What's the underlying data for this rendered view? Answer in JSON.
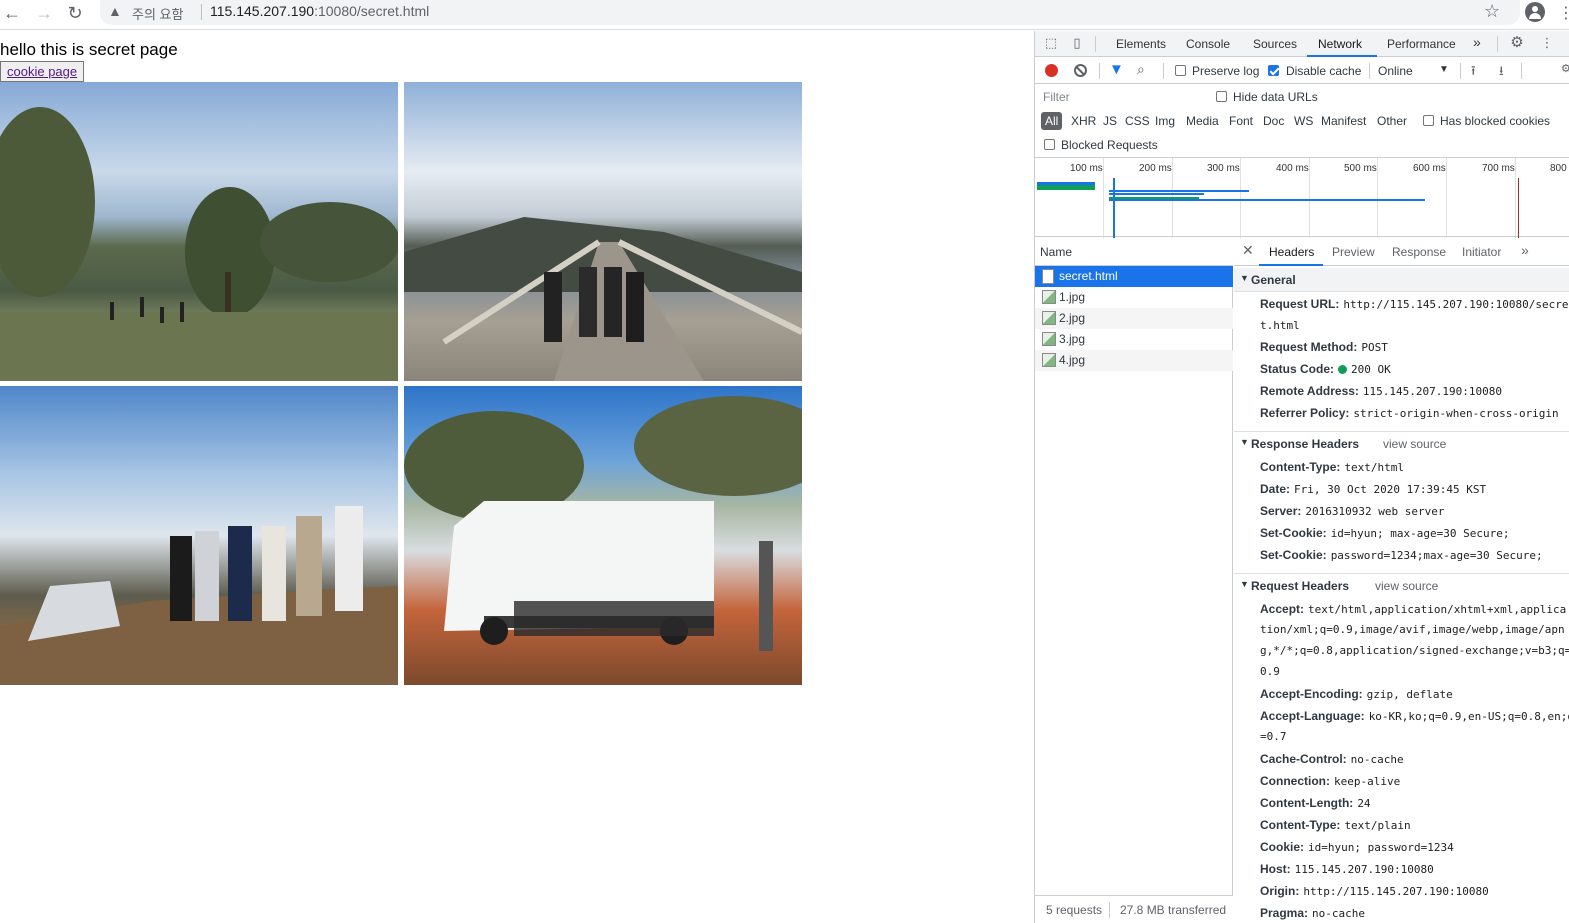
{
  "browser": {
    "security_label": "주의 요함",
    "url_host": "115.145.207.190",
    "url_rest": ":10080/secret.html"
  },
  "page": {
    "heading": "hello this is secret page",
    "cookie_button": "cookie page",
    "photos": [
      "lake-park-group",
      "pier-walkway-group",
      "hill-car-group",
      "campervan-group"
    ]
  },
  "devtools": {
    "tabs": [
      "Elements",
      "Console",
      "Sources",
      "Network",
      "Performance"
    ],
    "active_tab": "Network",
    "more_tabs": "»",
    "preserve_log": "Preserve log",
    "disable_cache": "Disable cache",
    "throttle": "Online",
    "filter_placeholder": "Filter",
    "hide_data_urls": "Hide data URLs",
    "types": [
      "All",
      "XHR",
      "JS",
      "CSS",
      "Img",
      "Media",
      "Font",
      "Doc",
      "WS",
      "Manifest",
      "Other"
    ],
    "has_blocked_cookies": "Has blocked cookies",
    "blocked_requests": "Blocked Requests",
    "timeline_labels": [
      "100 ms",
      "200 ms",
      "300 ms",
      "400 ms",
      "500 ms",
      "600 ms",
      "700 ms",
      "800"
    ],
    "name_header": "Name",
    "requests": [
      "secret.html",
      "1.jpg",
      "2.jpg",
      "3.jpg",
      "4.jpg"
    ],
    "footer_requests": "5 requests",
    "footer_transferred": "27.8 MB transferred",
    "detail_tabs": [
      "Headers",
      "Preview",
      "Response",
      "Initiator"
    ],
    "detail_more": "»",
    "general": {
      "title": "General",
      "request_url_key": "Request URL:",
      "request_url_val1": "http://115.145.207.190:10080/secre",
      "request_url_val2": "t.html",
      "method_key": "Request Method:",
      "method_val": "POST",
      "status_key": "Status Code:",
      "status_val": "200 OK",
      "remote_key": "Remote Address:",
      "remote_val": "115.145.207.190:10080",
      "referrer_key": "Referrer Policy:",
      "referrer_val": "strict-origin-when-cross-origin"
    },
    "response_headers": {
      "title": "Response Headers",
      "view_source": "view source",
      "items": [
        {
          "k": "Content-Type:",
          "v": "text/html"
        },
        {
          "k": "Date:",
          "v": "Fri, 30 Oct 2020 17:39:45 KST"
        },
        {
          "k": "Server:",
          "v": "2016310932 web server"
        },
        {
          "k": "Set-Cookie:",
          "v": "id=hyun; max-age=30 Secure;"
        },
        {
          "k": "Set-Cookie:",
          "v": "password=1234;max-age=30 Secure;"
        }
      ]
    },
    "request_headers": {
      "title": "Request Headers",
      "view_source": "view source",
      "accept_key": "Accept:",
      "accept_val1": "text/html,application/xhtml+xml,applica",
      "accept_val2": "tion/xml;q=0.9,image/avif,image/webp,image/apn",
      "accept_val3": "g,*/*;q=0.8,application/signed-exchange;v=b3;q=",
      "accept_val4": "0.9",
      "encoding_key": "Accept-Encoding:",
      "encoding_val": "gzip, deflate",
      "language_key": "Accept-Language:",
      "language_val1": "ko-KR,ko;q=0.9,en-US;q=0.8,en;q",
      "language_val2": "=0.7",
      "items": [
        {
          "k": "Cache-Control:",
          "v": "no-cache"
        },
        {
          "k": "Connection:",
          "v": "keep-alive"
        },
        {
          "k": "Content-Length:",
          "v": "24"
        },
        {
          "k": "Content-Type:",
          "v": "text/plain"
        },
        {
          "k": "Cookie:",
          "v": "id=hyun; password=1234"
        },
        {
          "k": "Host:",
          "v": "115.145.207.190:10080"
        },
        {
          "k": "Origin:",
          "v": "http://115.145.207.190:10080"
        },
        {
          "k": "Pragma:",
          "v": "no-cache"
        }
      ]
    }
  }
}
